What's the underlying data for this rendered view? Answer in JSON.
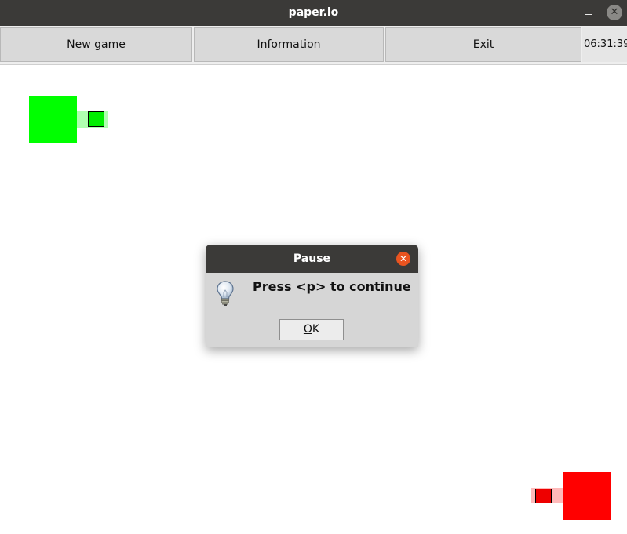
{
  "window": {
    "title": "paper.io",
    "minimize_glyph": "–",
    "close_glyph": "✕"
  },
  "toolbar": {
    "new_game_label": "New game",
    "information_label": "Information",
    "exit_label": "Exit",
    "clock": "06:31:39"
  },
  "dialog": {
    "title": "Pause",
    "message": "Press <p> to continue",
    "ok_label_mnemonic": "O",
    "ok_label_rest": "K",
    "close_glyph": "✕",
    "icon": "lightbulb-icon"
  },
  "game": {
    "players": [
      {
        "name": "green",
        "color": "#00ff00",
        "trail_color": "#9cff9c"
      },
      {
        "name": "red",
        "color": "#ff0000",
        "trail_color": "#ffb3b3"
      }
    ]
  },
  "colors": {
    "titlebar": "#3b3a38",
    "dialog_close": "#e95420",
    "toolbar_button": "#d9d9d9"
  }
}
